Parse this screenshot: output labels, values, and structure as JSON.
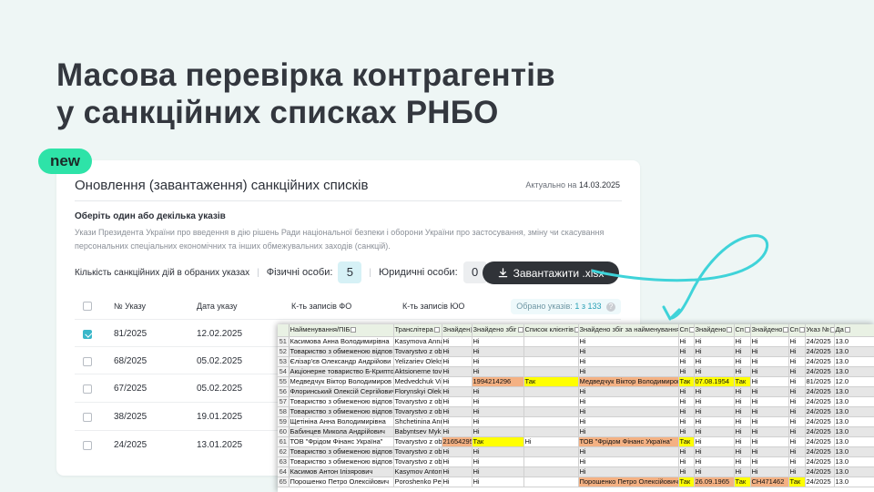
{
  "headline": {
    "line1": "Масова перевірка контрагентів",
    "line2": "у санкційних списках РНБО"
  },
  "badge": "new",
  "card": {
    "title": "Оновлення (завантаження) санкційних списків",
    "date_label": "Актуально на",
    "date_value": "14.03.2025",
    "section_title": "Оберіть один або декілька указів",
    "section_desc": "Укази Президента України про введення в дію рішень Ради національної безпеки і оборони України про застосування, зміну чи скасування персональних спеціальних економічних та інших обмежувальних заходів (санкцій).",
    "counts_label": "Кількість санкційних дій в обраних указах",
    "phys_label": "Фізичні особи:",
    "phys_count": "5",
    "legal_label": "Юридичні особи:",
    "legal_count": "0",
    "download_label": "Завантажити .xlsx",
    "columns": [
      "№ Указу",
      "Дата указу",
      "К-ть записів ФО",
      "К-ть записів ЮО"
    ],
    "selected_label": "Обрано указів:",
    "selected_value": "1 з 133",
    "rows": [
      {
        "num": "81/2025",
        "date": "12.02.2025",
        "checked": true
      },
      {
        "num": "68/2025",
        "date": "05.02.2025",
        "checked": false
      },
      {
        "num": "67/2025",
        "date": "05.02.2025",
        "checked": false
      },
      {
        "num": "38/2025",
        "date": "19.01.2025",
        "checked": false
      },
      {
        "num": "24/2025",
        "date": "13.01.2025",
        "checked": false
      }
    ]
  },
  "sheet": {
    "headers": [
      "Найменування/ПІБ",
      "Транслітера",
      "Знайден",
      "Знайдено збіг",
      "Список клієнтів",
      "Знайдено збіг за найменуванням",
      "Сп",
      "Знайдено",
      "Сп",
      "Знайдено",
      "Сп",
      "Указ №",
      "Да"
    ],
    "rows": [
      {
        "n": "51",
        "c": [
          "Касимова Анна Володимирівна",
          "Kasymova Anna",
          "Ні",
          "Ні",
          "",
          "Ні",
          "Ні",
          "Ні",
          "Ні",
          "Ні",
          "Ні",
          "24/2025",
          "13.0"
        ]
      },
      {
        "n": "52",
        "c": [
          "Товариство з обмеженою відпов",
          "Tovarystvo z ob",
          "Ні",
          "Ні",
          "",
          "Ні",
          "Ні",
          "Ні",
          "Ні",
          "Ні",
          "Ні",
          "24/2025",
          "13.0"
        ]
      },
      {
        "n": "53",
        "c": [
          "Єлізар'єв Олександр Андрійови",
          "Yelizariev Oleks",
          "Ні",
          "Ні",
          "",
          "Ні",
          "Ні",
          "Ні",
          "Ні",
          "Ні",
          "Ні",
          "24/2025",
          "13.0"
        ]
      },
      {
        "n": "54",
        "c": [
          "Акціонерне товариство Б-Крипто",
          "Aktsionerne tov",
          "Ні",
          "Ні",
          "",
          "Ні",
          "Ні",
          "Ні",
          "Ні",
          "Ні",
          "Ні",
          "24/2025",
          "13.0"
        ]
      },
      {
        "n": "55",
        "c": [
          "Медведчук Віктор Володимиров",
          "Medvedchuk Vik",
          "Ні",
          "1994214296",
          "Так",
          "Медведчук Віктор Володимиров",
          "Так",
          "07.08.1954",
          "Так",
          "Ні",
          "Ні",
          "81/2025",
          "12.0"
        ]
      },
      {
        "n": "56",
        "c": [
          "Флоринський Олексій Сергійович",
          "Florynskyi Olek",
          "Ні",
          "Ні",
          "",
          "Ні",
          "Ні",
          "Ні",
          "Ні",
          "Ні",
          "Ні",
          "24/2025",
          "13.0"
        ]
      },
      {
        "n": "57",
        "c": [
          "Товариство з обмеженою відпов",
          "Tovarystvo z ob",
          "Ні",
          "Ні",
          "",
          "Ні",
          "Ні",
          "Ні",
          "Ні",
          "Ні",
          "Ні",
          "24/2025",
          "13.0"
        ]
      },
      {
        "n": "58",
        "c": [
          "Товариство з обмеженою відпов",
          "Tovarystvo z ob",
          "Ні",
          "Ні",
          "",
          "Ні",
          "Ні",
          "Ні",
          "Ні",
          "Ні",
          "Ні",
          "24/2025",
          "13.0"
        ]
      },
      {
        "n": "59",
        "c": [
          "Щетініна Анна Володимирівна",
          "Shchetinina Ann",
          "Ні",
          "Ні",
          "",
          "Ні",
          "Ні",
          "Ні",
          "Ні",
          "Ні",
          "Ні",
          "24/2025",
          "13.0"
        ]
      },
      {
        "n": "60",
        "c": [
          "Бабинцев Микола Андрійович",
          "Babyntsev Myk",
          "Ні",
          "Ні",
          "",
          "Ні",
          "Ні",
          "Ні",
          "Ні",
          "Ні",
          "Ні",
          "24/2025",
          "13.0"
        ]
      },
      {
        "n": "61",
        "c": [
          "ТОВ \"Фрідом Фінанс Україна\"",
          "Tovarystvo z ob",
          "21654295",
          "Так",
          "Ні",
          "ТОВ \"Фрідом Фінанс Україна\"",
          "Так",
          "Ні",
          "Ні",
          "Ні",
          "Ні",
          "24/2025",
          "13.0"
        ]
      },
      {
        "n": "62",
        "c": [
          "Товариство з обмеженою відпов",
          "Tovarystvo z ob",
          "Ні",
          "Ні",
          "",
          "Ні",
          "Ні",
          "Ні",
          "Ні",
          "Ні",
          "Ні",
          "24/2025",
          "13.0"
        ]
      },
      {
        "n": "63",
        "c": [
          "Товариство з обмеженою відпов",
          "Tovarystvo z ob",
          "Ні",
          "Ні",
          "",
          "Ні",
          "Ні",
          "Ні",
          "Ні",
          "Ні",
          "Ні",
          "24/2025",
          "13.0"
        ]
      },
      {
        "n": "64",
        "c": [
          "Касимов Антон Ілізярович",
          "Kasymov Anton",
          "Ні",
          "Ні",
          "",
          "Ні",
          "Ні",
          "Ні",
          "Ні",
          "Ні",
          "Ні",
          "24/2025",
          "13.0"
        ]
      },
      {
        "n": "65",
        "c": [
          "Порошенко Петро Олексійович",
          "Poroshenko Pet",
          "Ні",
          "Ні",
          "",
          "Порошенко Петро Олексійович",
          "Так",
          "26.09.1965",
          "Так",
          "CH471462",
          "Так",
          "24/2025",
          "13.0"
        ]
      }
    ]
  },
  "colors": {
    "accent_badge": "#2ee3a8",
    "accent_teal": "#3ab7c9",
    "button_dark": "#303338",
    "highlight_orange": "#f4b183",
    "highlight_yellow": "#ffff00"
  }
}
